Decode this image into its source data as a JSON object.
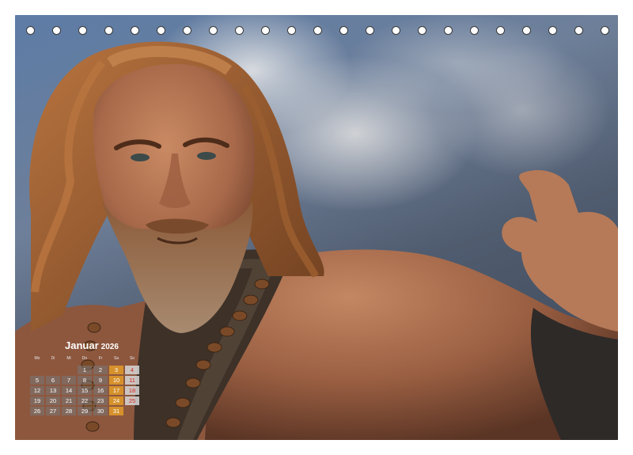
{
  "colors": {
    "saturday_bg": "#e9a028",
    "sunday_text": "#d22a20",
    "weekday_bg": "#787878",
    "hole_border": "#3a3a3a"
  },
  "binding": {
    "hole_count": 23
  },
  "calendar": {
    "month": "Januar",
    "year": "2026",
    "weekdays": [
      "Mo",
      "Di",
      "Mi",
      "Do",
      "Fr",
      "Sa",
      "So"
    ],
    "weeks": [
      [
        "",
        "",
        "",
        "1",
        "2",
        "3",
        "4"
      ],
      [
        "5",
        "6",
        "7",
        "8",
        "9",
        "10",
        "11"
      ],
      [
        "12",
        "13",
        "14",
        "15",
        "16",
        "17",
        "18"
      ],
      [
        "19",
        "20",
        "21",
        "22",
        "23",
        "24",
        "25"
      ],
      [
        "26",
        "27",
        "28",
        "29",
        "30",
        "31",
        ""
      ]
    ]
  },
  "photo": {
    "subject": "bearded-caveman-pointing",
    "accent_sky": "#5d7ca6"
  }
}
